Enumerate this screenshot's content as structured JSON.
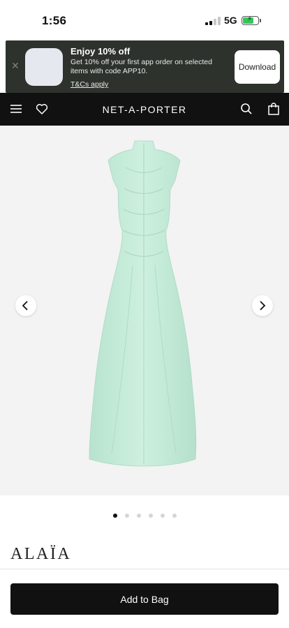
{
  "status_bar": {
    "time": "1:56",
    "network": "5G",
    "battery_percent": 70,
    "battery_color": "#34c759"
  },
  "app_banner": {
    "close_icon": "close-icon",
    "title": "Enjoy 10% off",
    "description": "Get 10% off your first app order on selected items with code APP10.",
    "terms_link": "T&Cs apply",
    "download_label": "Download"
  },
  "nav": {
    "brand": "NET-A-PORTER",
    "icons": [
      "menu-icon",
      "heart-icon",
      "search-icon",
      "shopping-bag-icon"
    ]
  },
  "product": {
    "image_color": "#c9eedd",
    "carousel": {
      "prev_icon": "chevron-left-icon",
      "next_icon": "chevron-right-icon",
      "total_images": 6,
      "current_image": 1
    },
    "designer": "ALAÏA"
  },
  "footer": {
    "add_to_bag_label": "Add to Bag"
  }
}
